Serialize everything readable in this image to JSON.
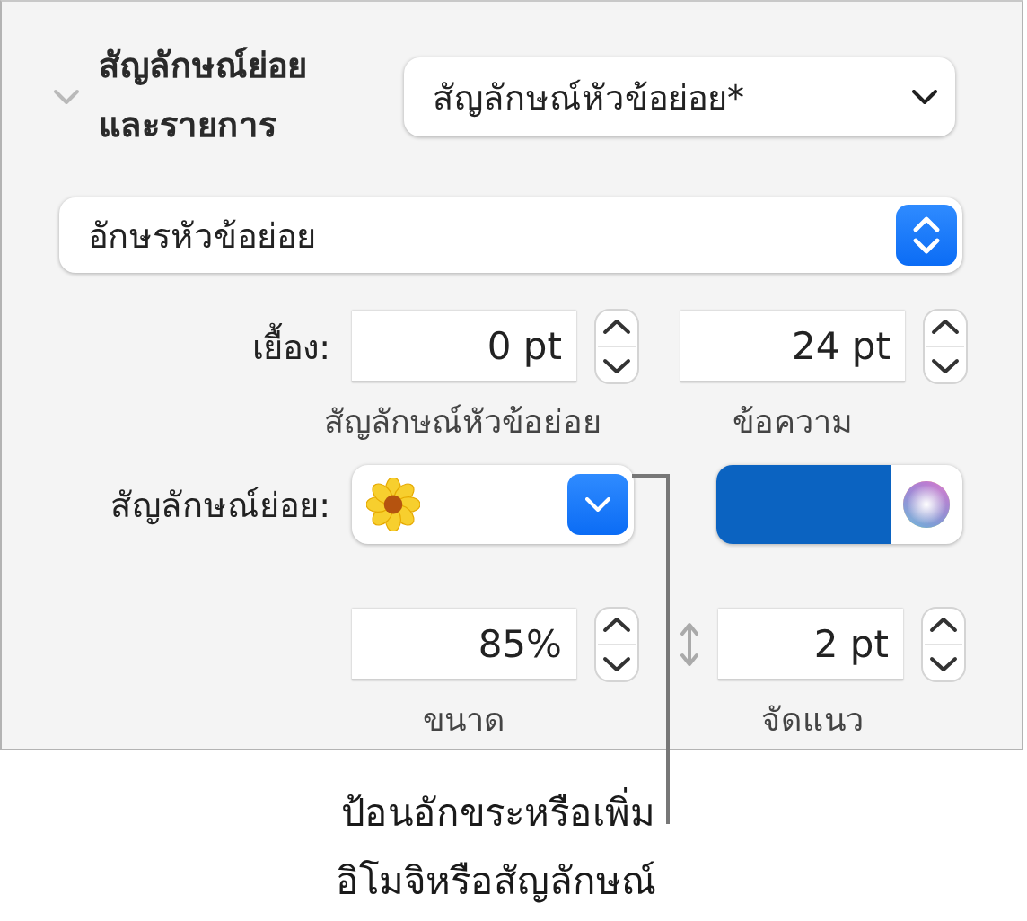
{
  "section": {
    "title": "สัญลักษณ์ย่อย\nและรายการ",
    "expanded": true,
    "list_style": "สัญลักษณ์หัวข้อย่อย*",
    "bullet_type": "อักษรหัวข้อย่อย"
  },
  "indent": {
    "label": "เยื้อง:",
    "fields": [
      {
        "value": "0 pt",
        "caption": "สัญลักษณ์หัวข้อย่อย"
      },
      {
        "value": "24 pt",
        "caption": "ข้อความ"
      }
    ]
  },
  "bullet": {
    "label": "สัญลักษณ์ย่อย:",
    "color": "#0b63c1"
  },
  "size": {
    "fields": [
      {
        "value": "85%",
        "caption": "ขนาด"
      },
      {
        "value": "2 pt",
        "caption": "จัดแนว"
      }
    ]
  },
  "callout": "ป้อนอักขระหรือเพิ่ม\nอิโมจิหรือสัญลักษณ์"
}
